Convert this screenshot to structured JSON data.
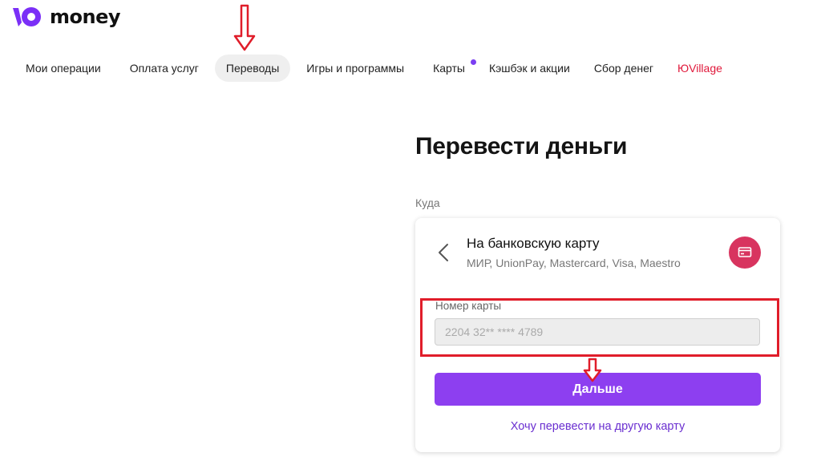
{
  "brand": {
    "name": "money",
    "color": "#7b2ff7"
  },
  "nav": {
    "items": [
      {
        "label": "Мои операции"
      },
      {
        "label": "Оплата услуг"
      },
      {
        "label": "Переводы",
        "active": true
      },
      {
        "label": "Игры и программы"
      },
      {
        "label": "Карты",
        "badge": true
      },
      {
        "label": "Кэшбэк и акции"
      },
      {
        "label": "Сбор денег"
      },
      {
        "label": "ЮVillage",
        "color": "#e0183a"
      }
    ],
    "badge_color": "#7b3ff2"
  },
  "main": {
    "title": "Перевести деньги",
    "to_label": "Куда",
    "method": {
      "title": "На банковскую карту",
      "subtitle": "МИР, UnionPay, Mastercard, Visa, Maestro",
      "icon": "card-icon",
      "icon_color": "#d8345f"
    },
    "card_field": {
      "label": "Номер карты",
      "value": "",
      "placeholder": "2204 32** **** 4789"
    },
    "next_button": {
      "label": "Дальше",
      "color": "#8d3ff0"
    },
    "other_link": {
      "label": "Хочу перевести на другую карту",
      "color": "#6a2fd0"
    }
  },
  "annotations": {
    "color": "#e01d2a"
  }
}
